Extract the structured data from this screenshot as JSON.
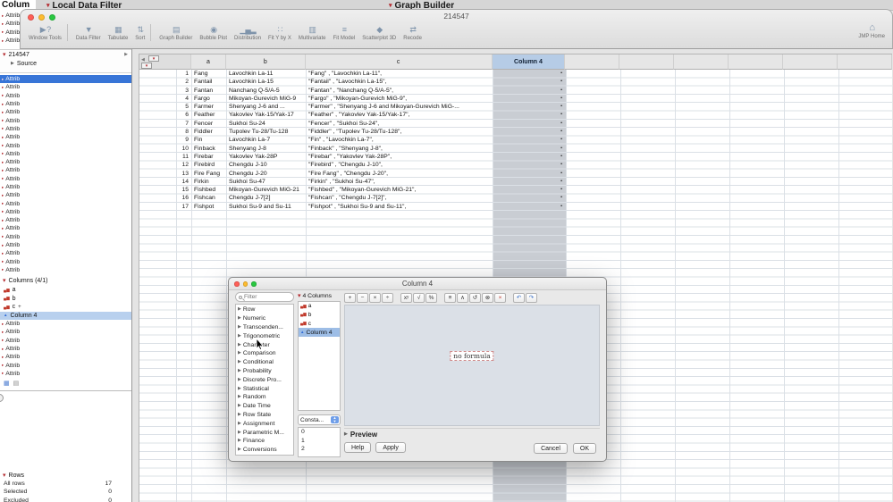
{
  "desktop": {
    "windows": [
      {
        "title": "Local Data Filter"
      },
      {
        "title": "Graph Builder"
      }
    ]
  },
  "window": {
    "title": "214547"
  },
  "toolbar": {
    "items": [
      {
        "label": "Window Tools",
        "glyph": "▶ ?",
        "sep_after": true
      },
      {
        "label": "Data Filter",
        "glyph": "▼"
      },
      {
        "label": "Tabulate",
        "glyph": "▦"
      },
      {
        "label": "Sort",
        "glyph": "⇅",
        "sep_after": true
      },
      {
        "label": "Graph Builder",
        "glyph": "▤"
      },
      {
        "label": "Bubble Plot",
        "glyph": "◉"
      },
      {
        "label": "Distribution",
        "glyph": "▁▄▂"
      },
      {
        "label": "Fit Y by X",
        "glyph": "∷"
      },
      {
        "label": "Multivariate",
        "glyph": "▥"
      },
      {
        "label": "Fit Model",
        "glyph": "≡"
      },
      {
        "label": "Scatterplot 3D",
        "glyph": "◆"
      },
      {
        "label": "Recode",
        "glyph": "⇄"
      }
    ],
    "home": {
      "label": "JMP Home",
      "glyph": "⌂"
    }
  },
  "sidebar": {
    "title": "Colum",
    "attrib_top": [
      "Attrib",
      "Attrib",
      "Attrib",
      "Attrib"
    ],
    "tree": {
      "root": "214547",
      "child": "Source"
    },
    "attrib_mid": [
      {
        "label": "Attrib",
        "selected": true
      },
      {
        "label": "Attrib"
      },
      {
        "label": "Attrib"
      },
      {
        "label": "Attrib"
      },
      {
        "label": "Attrib"
      },
      {
        "label": "Attrib"
      },
      {
        "label": "Attrib"
      },
      {
        "label": "Attrib"
      },
      {
        "label": "Attrib"
      },
      {
        "label": "Attrib"
      },
      {
        "label": "Attrib"
      },
      {
        "label": "Attrib"
      },
      {
        "label": "Attrib"
      },
      {
        "label": "Attrib"
      },
      {
        "label": "Attrib"
      },
      {
        "label": "Attrib"
      },
      {
        "label": "Attrib"
      },
      {
        "label": "Attrib"
      },
      {
        "label": "Attrib"
      },
      {
        "label": "Attrib"
      },
      {
        "label": "Attrib"
      },
      {
        "label": "Attrib"
      },
      {
        "label": "Attrib"
      },
      {
        "label": "Attrib"
      }
    ],
    "columns_panel": {
      "header": "Columns (4/1)",
      "items": [
        {
          "label": "a",
          "glyph": "▄▆",
          "nominal": true
        },
        {
          "label": "b",
          "glyph": "▄▆",
          "nominal": true
        },
        {
          "label": "c",
          "glyph": "▄▆",
          "nominal": true,
          "badge": "+"
        },
        {
          "label": "Column 4",
          "glyph": "▲",
          "continuous": true,
          "selected": true
        }
      ]
    },
    "attrib_bottom": [
      "Attrib",
      "Attrib",
      "Attrib",
      "Attrib",
      "Attrib",
      "Attrib",
      "Attrib"
    ],
    "rows_panel": {
      "header": "Rows",
      "stats": [
        {
          "label": "All rows",
          "value": "17"
        },
        {
          "label": "Selected",
          "value": "0"
        },
        {
          "label": "Excluded",
          "value": "0"
        }
      ]
    }
  },
  "table": {
    "headers": {
      "a": "a",
      "b": "b",
      "c": "c",
      "col4": "Column 4"
    },
    "rows": [
      {
        "n": "1",
        "a": "Fang",
        "b": "Lavochkin La-11",
        "c": "\"Fang\" , \"Lavochkin La-11\",",
        "d": "•"
      },
      {
        "n": "2",
        "a": "Fantail",
        "b": "Lavochkin La-15",
        "c": "\"Fantail\" , \"Lavochkin La-15\",",
        "d": "•"
      },
      {
        "n": "3",
        "a": "Fantan",
        "b": "Nanchang Q-5/A-5",
        "c": "\"Fantan\" , \"Nanchang Q-5/A-5\",",
        "d": "•"
      },
      {
        "n": "4",
        "a": "Fargo",
        "b": "Mikoyan-Gurevich MiG-9",
        "c": "\"Fargo\" , \"Mikoyan-Gurevich MiG-9\",",
        "d": "•"
      },
      {
        "n": "5",
        "a": "Farmer",
        "b": "Shenyang J-6 and ...",
        "c": "\"Farmer\" , \"Shenyang J-6 and Mikoyan-Gurevich MiG-...",
        "d": "•"
      },
      {
        "n": "6",
        "a": "Feather",
        "b": "Yakovlev Yak-15/Yak-17",
        "c": "\"Feather\" , \"Yakovlev Yak-15/Yak-17\",",
        "d": "•"
      },
      {
        "n": "7",
        "a": "Fencer",
        "b": "Sukhoi Su-24",
        "c": "\"Fencer\" , \"Sukhoi Su-24\",",
        "d": "•"
      },
      {
        "n": "8",
        "a": "Fiddler",
        "b": "Tupolev Tu-28/Tu-128",
        "c": "\"Fiddler\" , \"Tupolev Tu-28/Tu-128\",",
        "d": "•"
      },
      {
        "n": "9",
        "a": "Fin",
        "b": "Lavochkin La-7",
        "c": "\"Fin\" , \"Lavochkin La-7\",",
        "d": "•"
      },
      {
        "n": "10",
        "a": "Finback",
        "b": "Shenyang J-8",
        "c": "\"Finback\" , \"Shenyang J-8\",",
        "d": "•"
      },
      {
        "n": "11",
        "a": "Firebar",
        "b": "Yakovlev Yak-28P",
        "c": "\"Firebar\" , \"Yakovlev Yak-28P\",",
        "d": "•"
      },
      {
        "n": "12",
        "a": "Firebird",
        "b": "Chengdu J-10",
        "c": "\"Firebird\" , \"Chengdu J-10\",",
        "d": "•"
      },
      {
        "n": "13",
        "a": "Fire Fang",
        "b": "Chengdu J-20",
        "c": "\"Fire Fang\" , \"Chengdu J-20\",",
        "d": "•"
      },
      {
        "n": "14",
        "a": "Firkin",
        "b": "Sukhoi Su-47",
        "c": "\"Firkin\" , \"Sukhoi Su-47\",",
        "d": "•"
      },
      {
        "n": "15",
        "a": "Fishbed",
        "b": "Mikoyan-Gurevich MiG-21",
        "c": "\"Fishbed\" , \"Mikoyan-Gurevich MiG-21\",",
        "d": "•"
      },
      {
        "n": "16",
        "a": "Fishcan",
        "b": "Chengdu J-7[2]",
        "c": "\"Fishcan\" , \"Chengdu J-7[2]\",",
        "d": "•"
      },
      {
        "n": "17",
        "a": "Fishpot",
        "b": "Sukhoi Su-9 and Su-11",
        "c": "\"Fishpot\" , \"Sukhoi Su-9 and Su-11\",",
        "d": "•"
      }
    ]
  },
  "dialog": {
    "title": "Column 4",
    "filter": {
      "placeholder": "Filter"
    },
    "functions": [
      "Row",
      "Numeric",
      "Transcenden...",
      "Trigonometric",
      "Character",
      "Comparison",
      "Conditional",
      "Probability",
      "Discrete Pro...",
      "Statistical",
      "Random",
      "Date Time",
      "Row State",
      "Assignment",
      "Parametric M...",
      "Finance",
      "Conversions"
    ],
    "columns_header": "4 Columns",
    "columns": [
      {
        "label": "a",
        "glyph": "▄▆",
        "nominal": true
      },
      {
        "label": "b",
        "glyph": "▄▆",
        "nominal": true
      },
      {
        "label": "c",
        "glyph": "▄▆",
        "nominal": true
      },
      {
        "label": "Column 4",
        "glyph": "▲",
        "continuous": true,
        "selected": true
      }
    ],
    "constants": {
      "label": "Consta...",
      "items": [
        "0",
        "1",
        "2"
      ]
    },
    "ops": [
      {
        "glyph": "+"
      },
      {
        "glyph": "−"
      },
      {
        "glyph": "×"
      },
      {
        "glyph": "÷"
      },
      {
        "glyph": "xʸ",
        "gap": true
      },
      {
        "glyph": "√"
      },
      {
        "glyph": "%"
      },
      {
        "glyph": "≡",
        "gap": true
      },
      {
        "glyph": "∧"
      },
      {
        "glyph": "↺"
      },
      {
        "glyph": "⊗"
      },
      {
        "glyph": "×",
        "red": true
      },
      {
        "glyph": "↶",
        "gap": true,
        "blue": true
      },
      {
        "glyph": "↷",
        "blue": true
      }
    ],
    "formula_placeholder": "no formula",
    "preview_label": "Preview",
    "left_buttons": [
      {
        "label": "Help"
      },
      {
        "label": "Apply"
      }
    ],
    "footer_buttons": [
      {
        "label": "Cancel"
      },
      {
        "label": "OK"
      }
    ]
  }
}
